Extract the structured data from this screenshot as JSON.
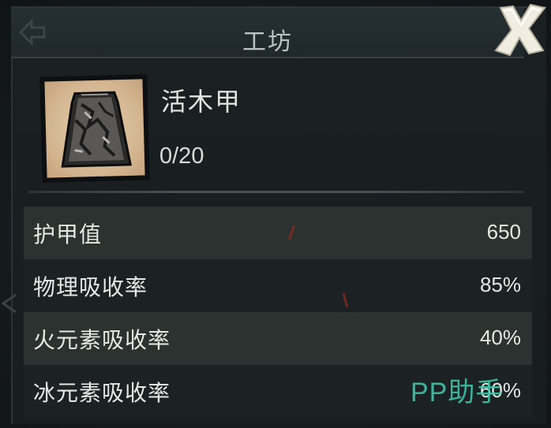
{
  "window": {
    "title": "工坊"
  },
  "item": {
    "name": "活木甲",
    "count": "0/20",
    "icon": "wooden-armor-icon"
  },
  "stats": [
    {
      "label": "护甲值",
      "value": "650"
    },
    {
      "label": "物理吸收率",
      "value": "85%"
    },
    {
      "label": "火元素吸收率",
      "value": "40%"
    },
    {
      "label": "冰元素吸收率",
      "value": "60%"
    }
  ],
  "watermark": "PP助手",
  "colors": {
    "panel": "#1a2022",
    "row_light": "#2b3230",
    "row_dark": "#1c2223",
    "text": "#e6e8e4",
    "item_bg": "#d2b48f",
    "watermark": "#3fc4a8"
  }
}
